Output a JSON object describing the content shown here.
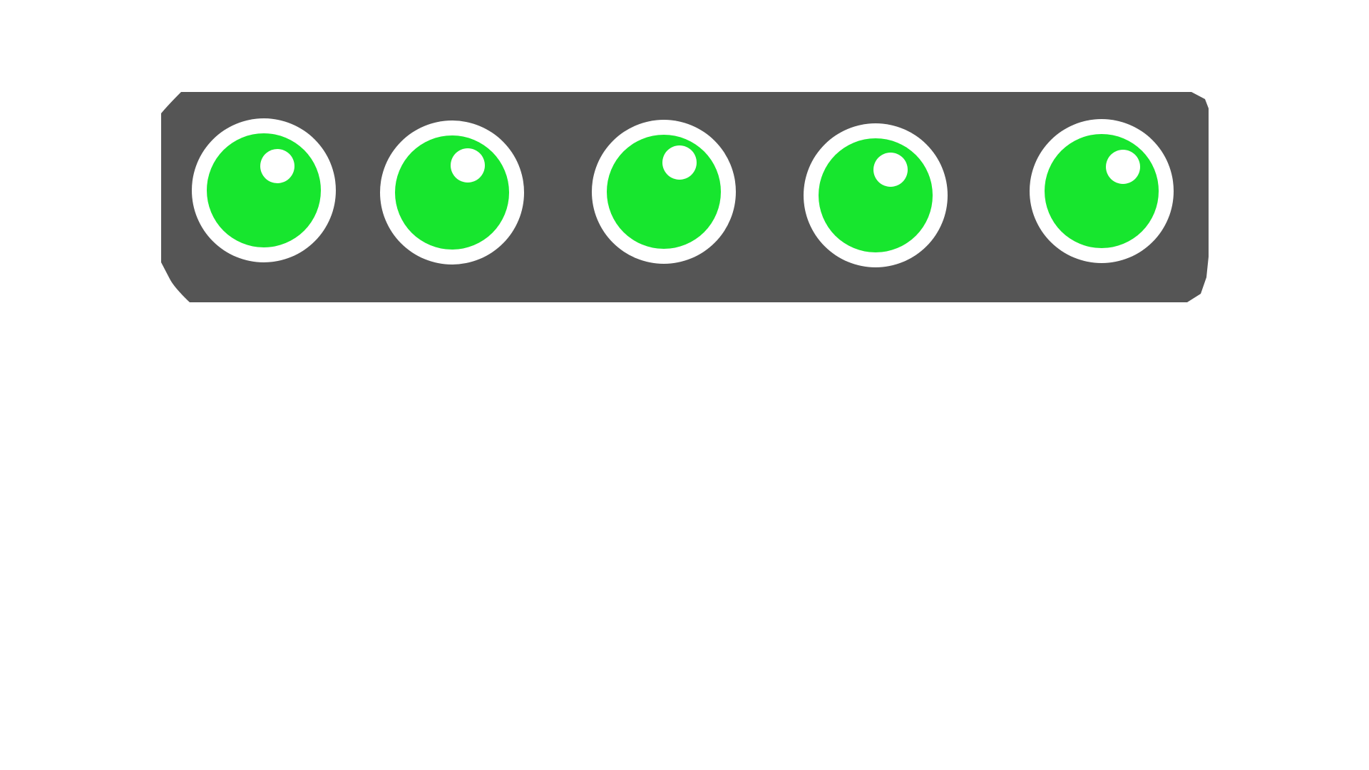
{
  "canvas": {
    "background": "#ffffff"
  },
  "signal_bar": {
    "fill_color": "#555555",
    "lamp_ring_color": "#ffffff",
    "lamp_color": "#17e62e",
    "highlight_color": "#ffffff",
    "lamps": [
      {
        "name": "signal-lamp-1",
        "state": "on",
        "color": "green"
      },
      {
        "name": "signal-lamp-2",
        "state": "on",
        "color": "green"
      },
      {
        "name": "signal-lamp-3",
        "state": "on",
        "color": "green"
      },
      {
        "name": "signal-lamp-4",
        "state": "on",
        "color": "green"
      },
      {
        "name": "signal-lamp-5",
        "state": "on",
        "color": "green"
      }
    ]
  }
}
